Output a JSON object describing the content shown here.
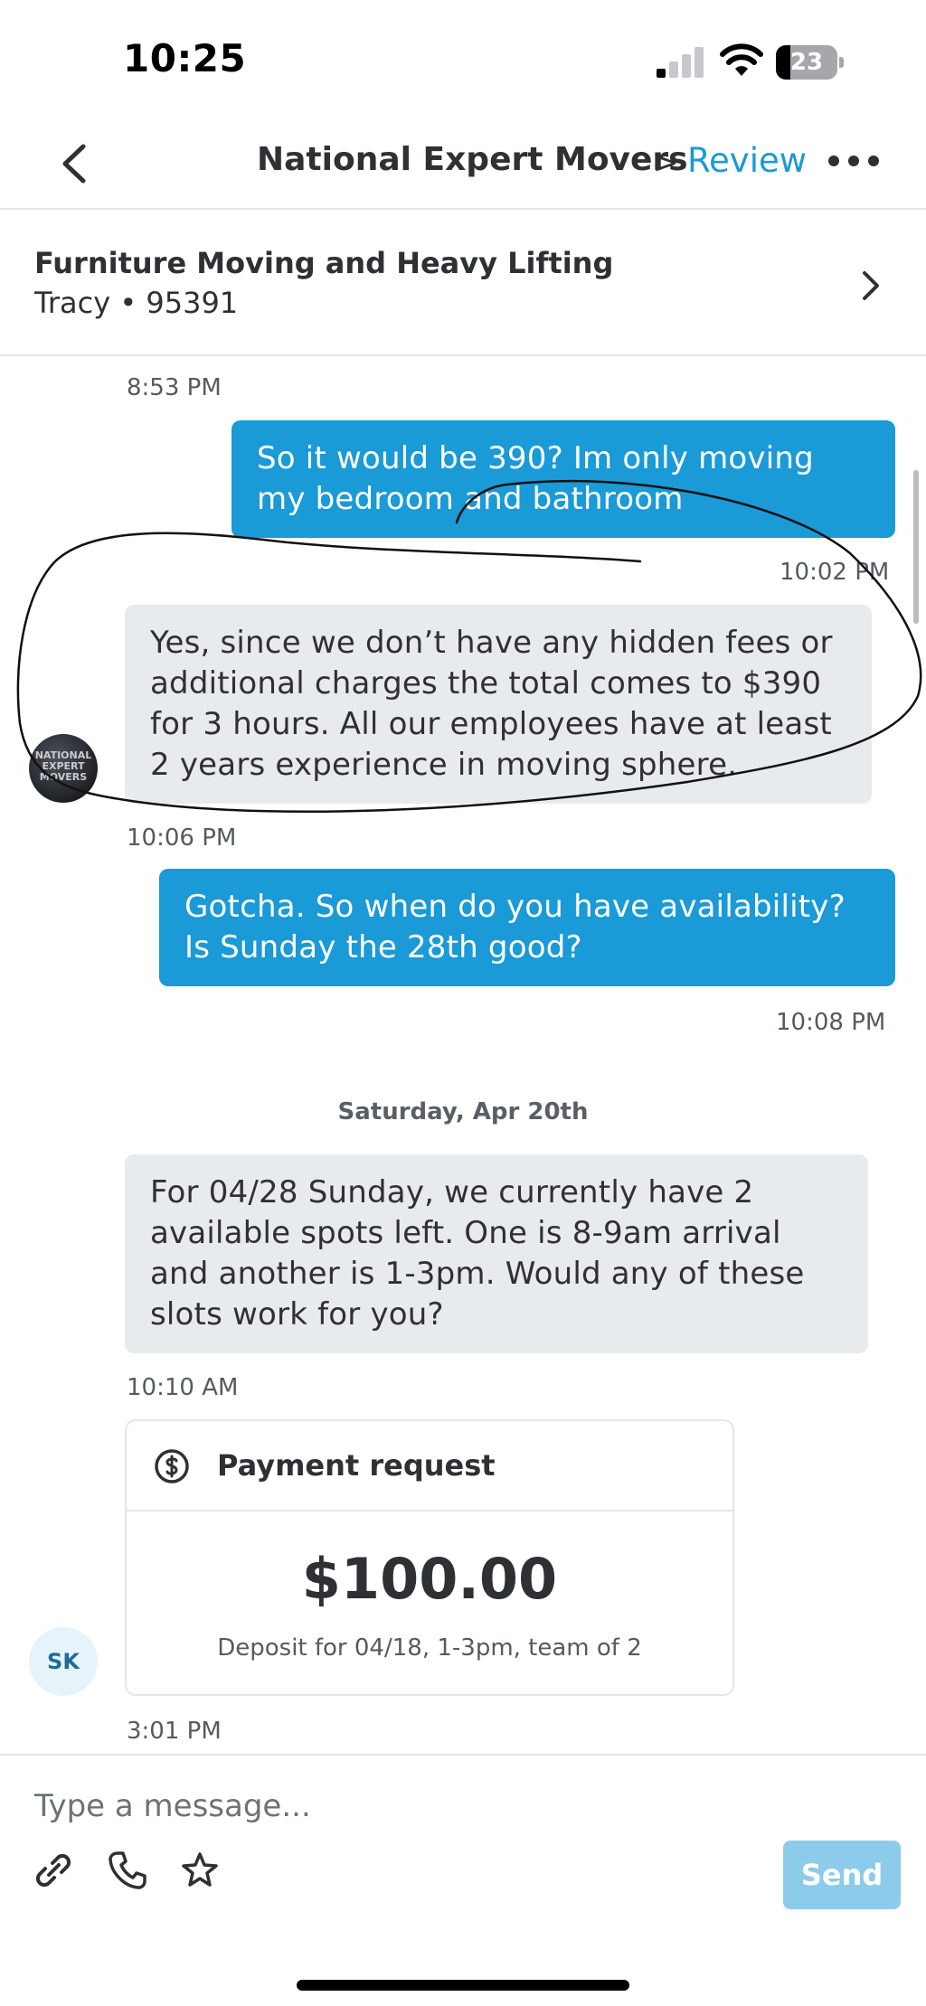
{
  "status_bar": {
    "time": "10:25",
    "battery": "23"
  },
  "header": {
    "title": "National Expert Movers",
    "chevron": ">",
    "review_label": "Review"
  },
  "service": {
    "title": "Furniture Moving and Heavy Lifting",
    "subtitle": "Tracy • 95391"
  },
  "messages": [
    {
      "timestamp": "8:53 PM",
      "from": "me",
      "text": "So it would be 390? Im only moving my bedroom and bathroom"
    },
    {
      "timestamp": "10:02 PM",
      "from": "pro",
      "text": "Yes, since we don’t have any hidden fees or additional charges the total comes to $390 for 3 hours. All our employees have at least 2 years experience in moving sphere."
    },
    {
      "timestamp": "10:06 PM",
      "from": "me",
      "text": "Gotcha. So when do you have availability? Is Sunday the 28th good?"
    },
    {
      "timestamp": "10:08 PM"
    },
    {
      "date_separator": "Saturday, Apr 20th",
      "from": "pro",
      "text": "For 04/28 Sunday, we currently have 2 available spots left. One is 8-9am arrival and another is 1-3pm. Would any of these slots work for you?"
    },
    {
      "timestamp": "10:10 AM"
    }
  ],
  "avatars": {
    "pro_logo_text": "NATIONAL EXPERT MOVERS",
    "user_initials": "SK"
  },
  "payment_request": {
    "title": "Payment request",
    "amount": "$100.00",
    "description": "Deposit for 04/18, 1-3pm, team of 2",
    "timestamp": "3:01 PM"
  },
  "composer": {
    "placeholder": "Type a message...",
    "send_label": "Send"
  },
  "colors": {
    "accent": "#1a9ad6",
    "incoming_bubble": "#e8ebed",
    "send_disabled": "#8ccbea"
  },
  "icons": [
    "back-chevron-icon",
    "more-icon",
    "chevron-right-icon",
    "dollar-icon",
    "paperclip-icon",
    "phone-icon",
    "star-icon"
  ]
}
